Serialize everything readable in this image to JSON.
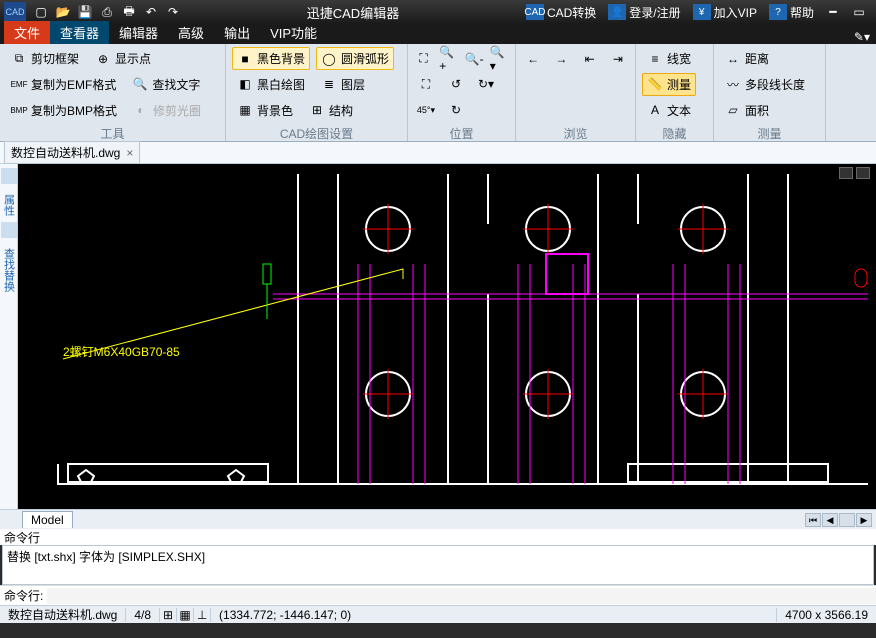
{
  "titlebar": {
    "title": "迅捷CAD编辑器",
    "qat": [
      "new",
      "open",
      "save",
      "saveas",
      "print",
      "undo",
      "redo"
    ],
    "cad_convert": "CAD转换",
    "login": "登录/注册",
    "vip": "加入VIP",
    "help": "帮助"
  },
  "tabs": {
    "file": "文件",
    "viewer": "查看器",
    "editor": "编辑器",
    "advanced": "高级",
    "output": "输出",
    "vip": "VIP功能"
  },
  "ribbon": {
    "tools": {
      "label": "工具",
      "cut_frame": "剪切框架",
      "copy_emf": "复制为EMF格式",
      "copy_bmp": "复制为BMP格式",
      "show_point": "显示点",
      "find_text": "查找文字",
      "edit_light": "修剪光圈"
    },
    "cad": {
      "label": "CAD绘图设置",
      "black_bg": "黑色背景",
      "bw_draw": "黑白绘图",
      "scenery": "背景色",
      "smooth_arc": "圆滑弧形",
      "layer": "图层",
      "structure": "结构"
    },
    "position": {
      "label": "位置"
    },
    "browse": {
      "label": "浏览"
    },
    "hide": {
      "label": "隐藏",
      "line_width": "线宽",
      "measure": "测量",
      "text": "文本"
    },
    "measure": {
      "label": "测量",
      "distance": "距离",
      "polyline": "多段线长度",
      "area": "面积"
    }
  },
  "doc": {
    "name": "数控自动送料机.dwg"
  },
  "side": {
    "props": "属性",
    "find": "查找替换"
  },
  "canvas": {
    "label": "2螺钉M6X40GB70-85"
  },
  "model": {
    "label": "Model"
  },
  "cmd": {
    "label": "命令行",
    "output": "替换 [txt.shx] 字体为 [SIMPLEX.SHX]",
    "prompt": "命令行:"
  },
  "status": {
    "file": "数控自动送料机.dwg",
    "page": "4/8",
    "coords": "(1334.772; -1446.147; 0)",
    "size": "4700 x 3566.19"
  }
}
